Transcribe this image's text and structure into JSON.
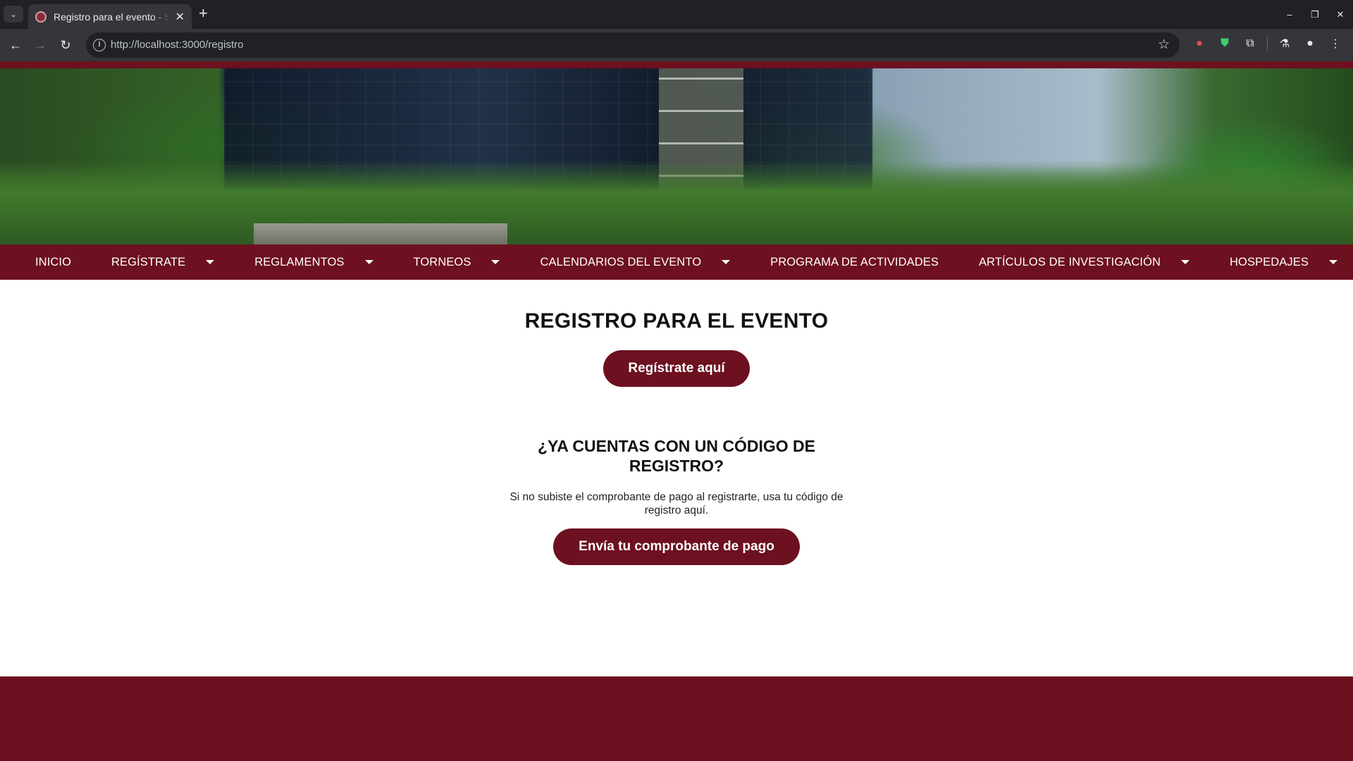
{
  "browser": {
    "tab_title": "Registro para el evento - Si",
    "url": "http://localhost:3000/registro",
    "new_tab_label": "+",
    "window_controls": [
      "–",
      "❐",
      "✕"
    ]
  },
  "page": {
    "nav": {
      "items": [
        {
          "label": "INICIO",
          "dropdown": false
        },
        {
          "label": "REGÍSTRATE",
          "dropdown": true
        },
        {
          "label": "REGLAMENTOS",
          "dropdown": true
        },
        {
          "label": "TORNEOS",
          "dropdown": true
        },
        {
          "label": "CALENDARIOS DEL EVENTO",
          "dropdown": true
        },
        {
          "label": "PROGRAMA DE ACTIVIDADES",
          "dropdown": false
        },
        {
          "label": "ARTÍCULOS DE INVESTIGACIÓN",
          "dropdown": true
        },
        {
          "label": "HOSPEDAJES",
          "dropdown": true
        }
      ]
    },
    "title": "REGISTRO PARA EL EVENTO",
    "register_button": "Regístrate aquí",
    "code_heading": "¿YA CUENTAS CON UN CÓDIGO DE REGISTRO?",
    "code_note": "Si no subiste el comprobante de pago al registrarte, usa tu código de registro aquí.",
    "receipt_button": "Envía tu comprobante de pago"
  },
  "colors": {
    "brand": "#6d1020",
    "chrome_dark": "#202124",
    "chrome_toolbar": "#35363a"
  }
}
